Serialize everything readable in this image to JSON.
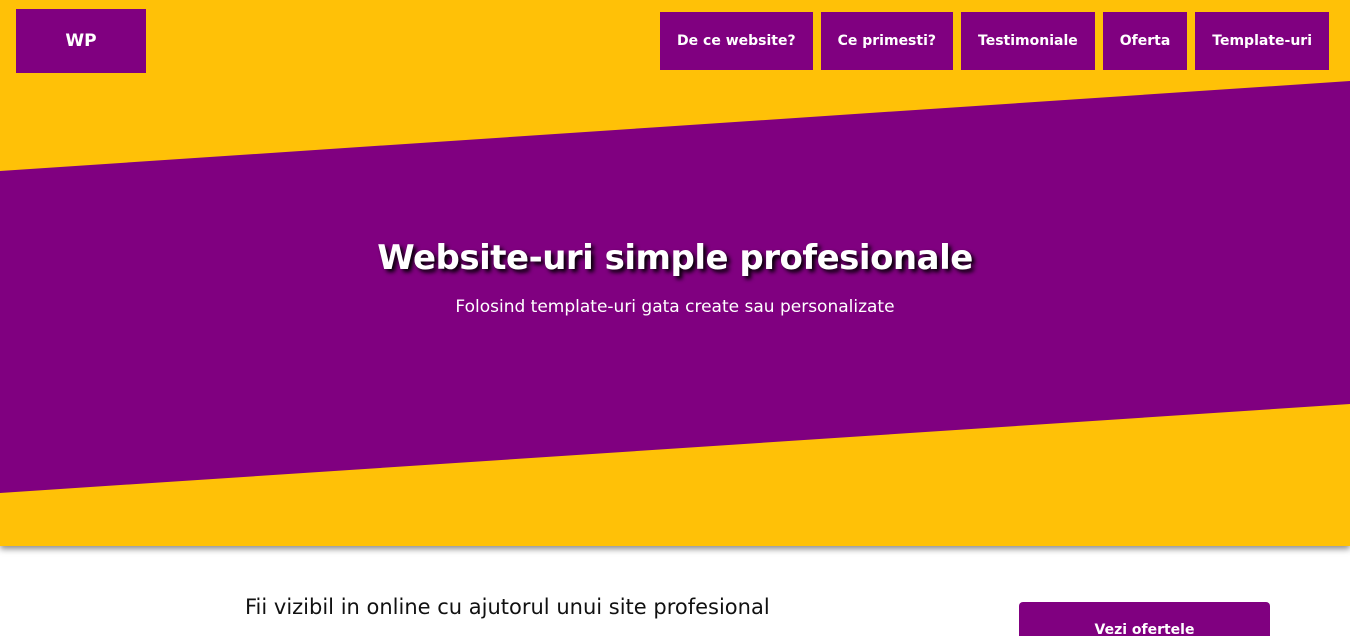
{
  "brand": {
    "logo_text": "WP"
  },
  "nav": {
    "items": [
      {
        "label": "De ce website?"
      },
      {
        "label": "Ce primesti?"
      },
      {
        "label": "Testimoniale"
      },
      {
        "label": "Oferta"
      },
      {
        "label": "Template-uri"
      }
    ]
  },
  "hero": {
    "title": "Website-uri simple profesionale",
    "subtitle": "Folosind template-uri gata create sau personalizate"
  },
  "cta": {
    "heading": "Fii vizibil in online cu ajutorul unui site profesional",
    "button_label": "Vezi ofertele"
  },
  "colors": {
    "primary": "#800080",
    "accent": "#ffc107",
    "text_light": "#ffffff",
    "text_dark": "#111111"
  }
}
